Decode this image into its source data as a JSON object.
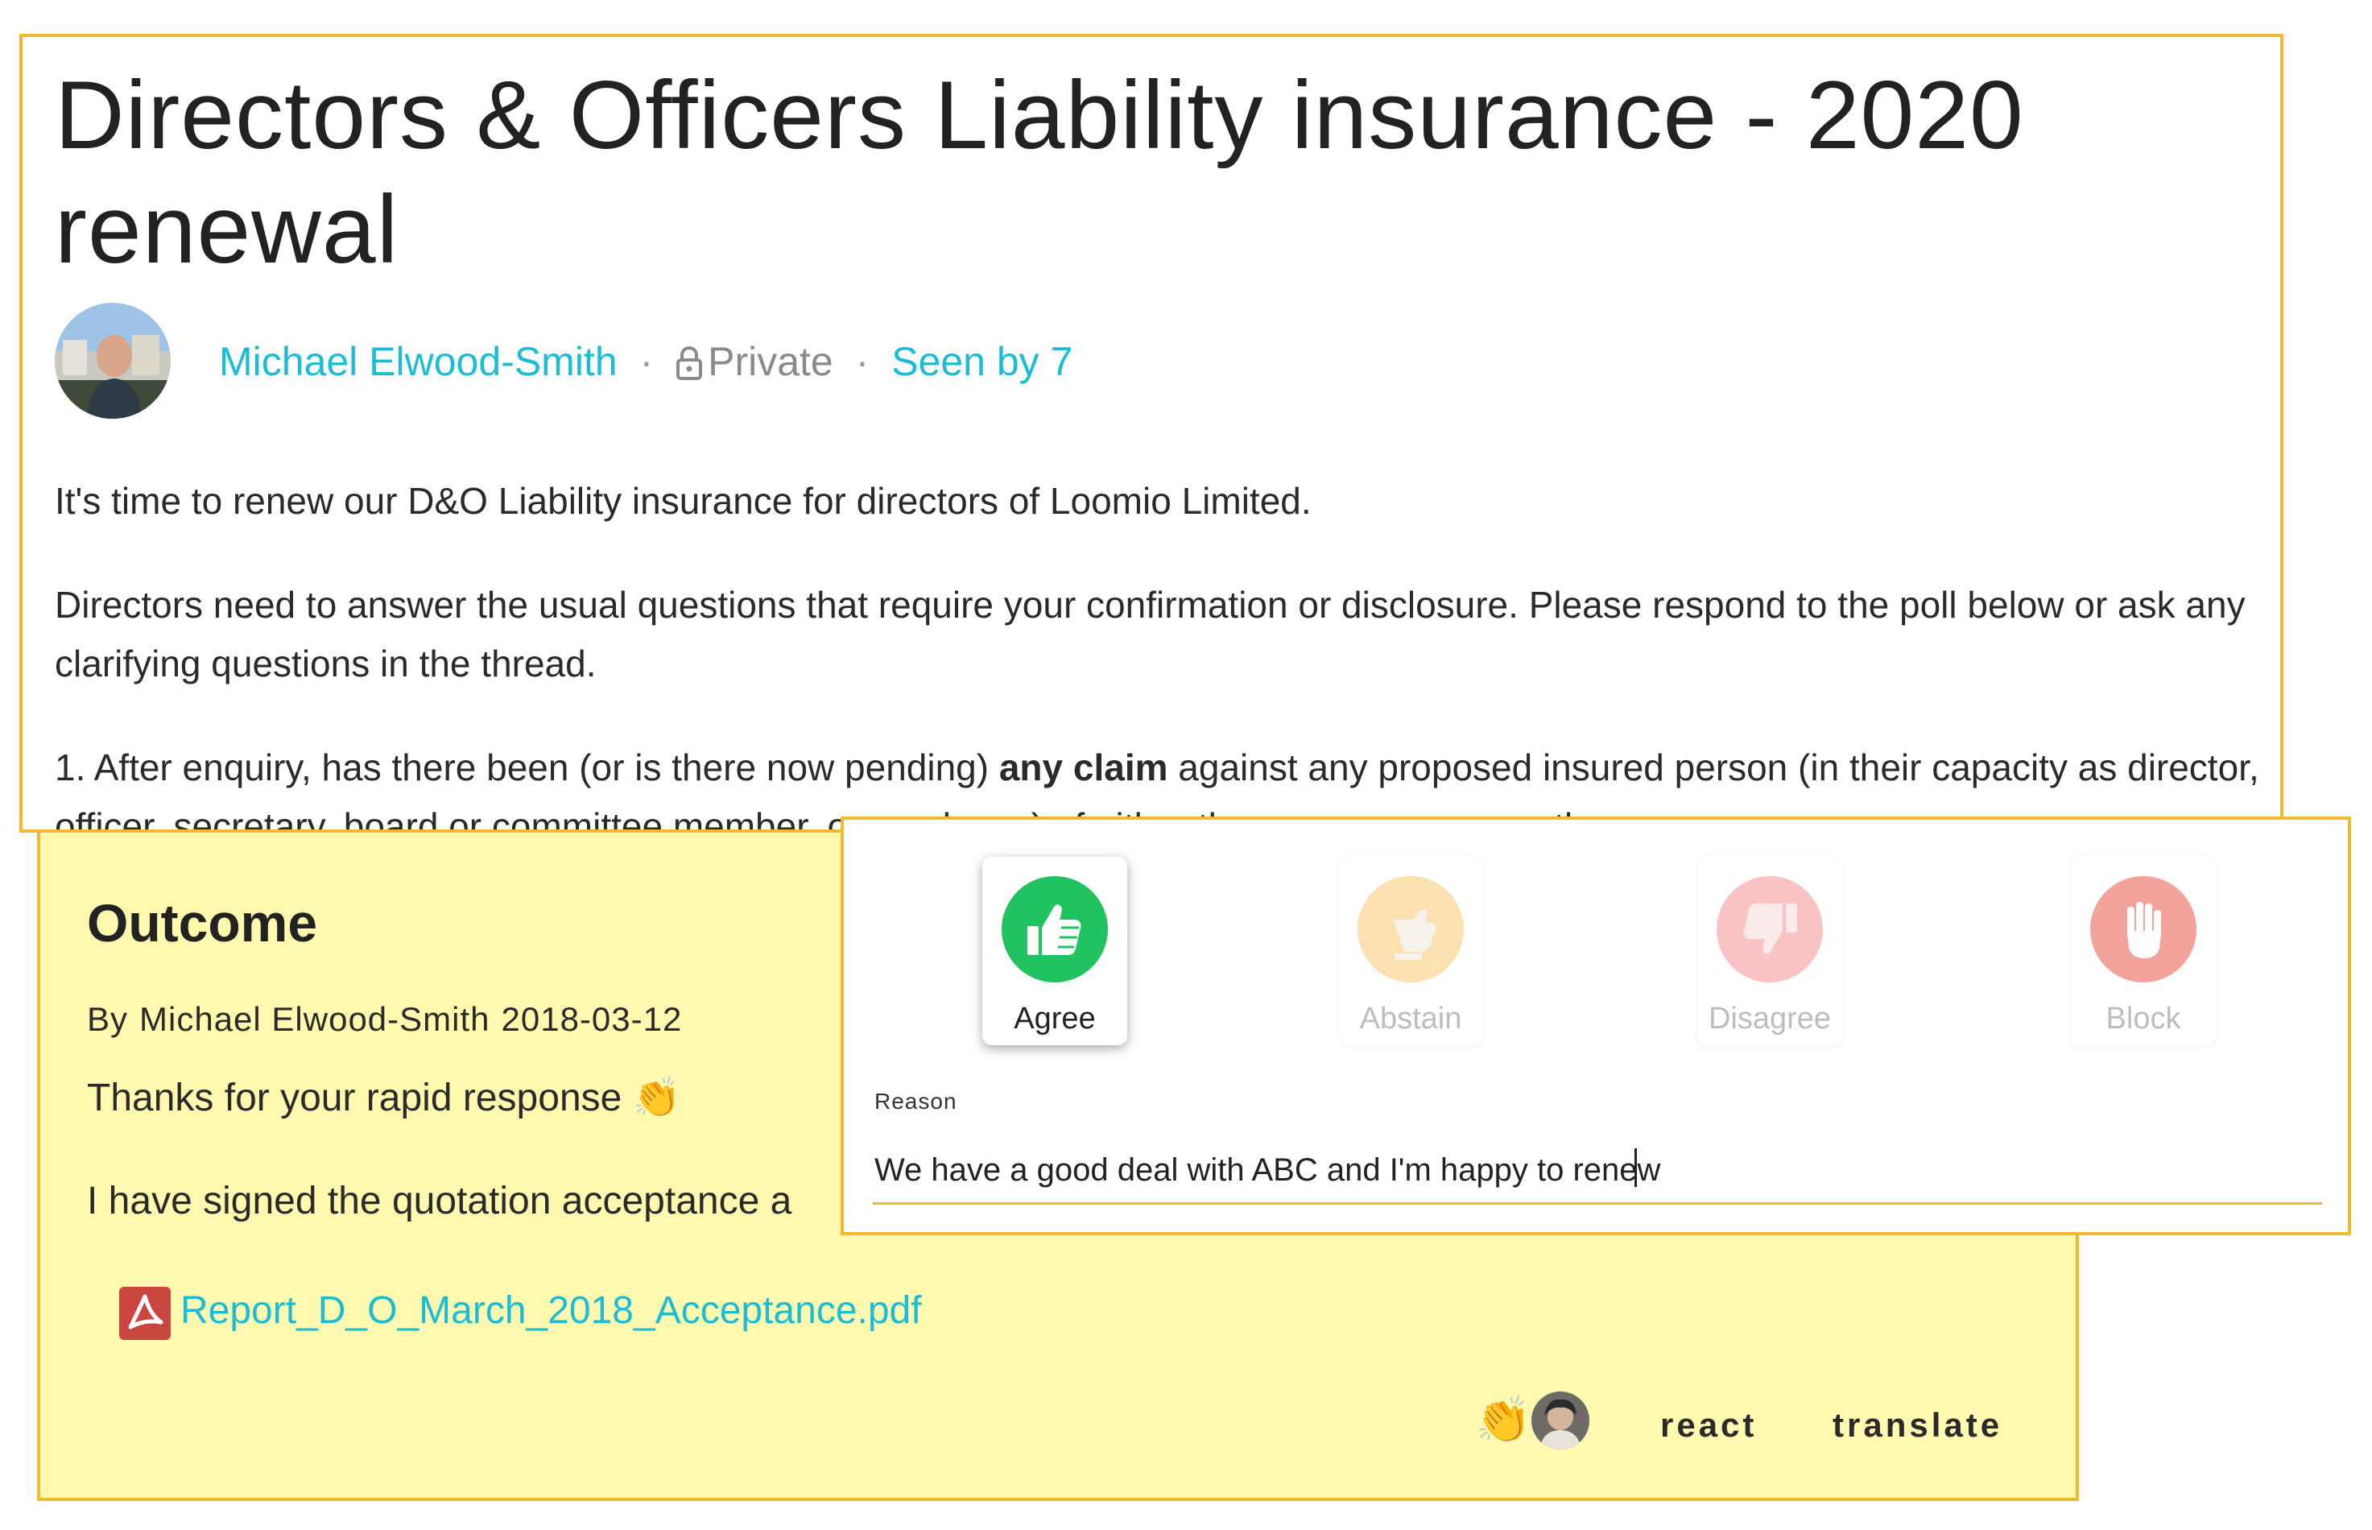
{
  "thread": {
    "title": "Directors & Officers Liability insurance - 2020 renewal",
    "author": "Michael Elwood-Smith",
    "separator": "·",
    "privacy": "Private",
    "seen_by": "Seen by 7",
    "paragraph_1": "It's time to renew our D&O Liability insurance for directors of Loomio Limited.",
    "paragraph_2": "Directors need to answer the usual questions that require your confirmation or disclosure. Please respond to the poll below or ask any clarifying questions in the thread.",
    "paragraph_3_before": "1. After enquiry, has there been (or is there now pending) ",
    "paragraph_3_bold": "any claim",
    "paragraph_3_after": " against any proposed insured person (in their capacity as director, officer, secretary, board or committee member, or employee) of either the company or any other"
  },
  "outcome": {
    "title": "Outcome",
    "by_prefix": "By",
    "author": "Michael Elwood-Smith",
    "date": "2018-03-12",
    "thanks_text": "Thanks for your rapid response",
    "thanks_emoji": "👏",
    "signed_text": "I have signed the quotation acceptance a",
    "attachment": "Report_D_O_March_2018_Acceptance.pdf",
    "reaction_emoji": "👏",
    "react_label": "react",
    "translate_label": "translate"
  },
  "vote": {
    "options": [
      {
        "label": "Agree",
        "icon": "thumbs-up-icon",
        "color": "#20c35f",
        "selected": true
      },
      {
        "label": "Abstain",
        "icon": "thumb-sideways-icon",
        "color": "#fbe0b0",
        "selected": false
      },
      {
        "label": "Disagree",
        "icon": "thumbs-down-icon",
        "color": "#f9c3c3",
        "selected": false
      },
      {
        "label": "Block",
        "icon": "raised-hand-icon",
        "color": "#f4a29c",
        "selected": false
      }
    ],
    "reason_label": "Reason",
    "reason_value": "We have a good deal with ABC and I'm happy to renew"
  },
  "colors": {
    "accent_border": "#f1b92f",
    "link": "#1bbcd6",
    "outcome_bg": "#fff9b0"
  }
}
